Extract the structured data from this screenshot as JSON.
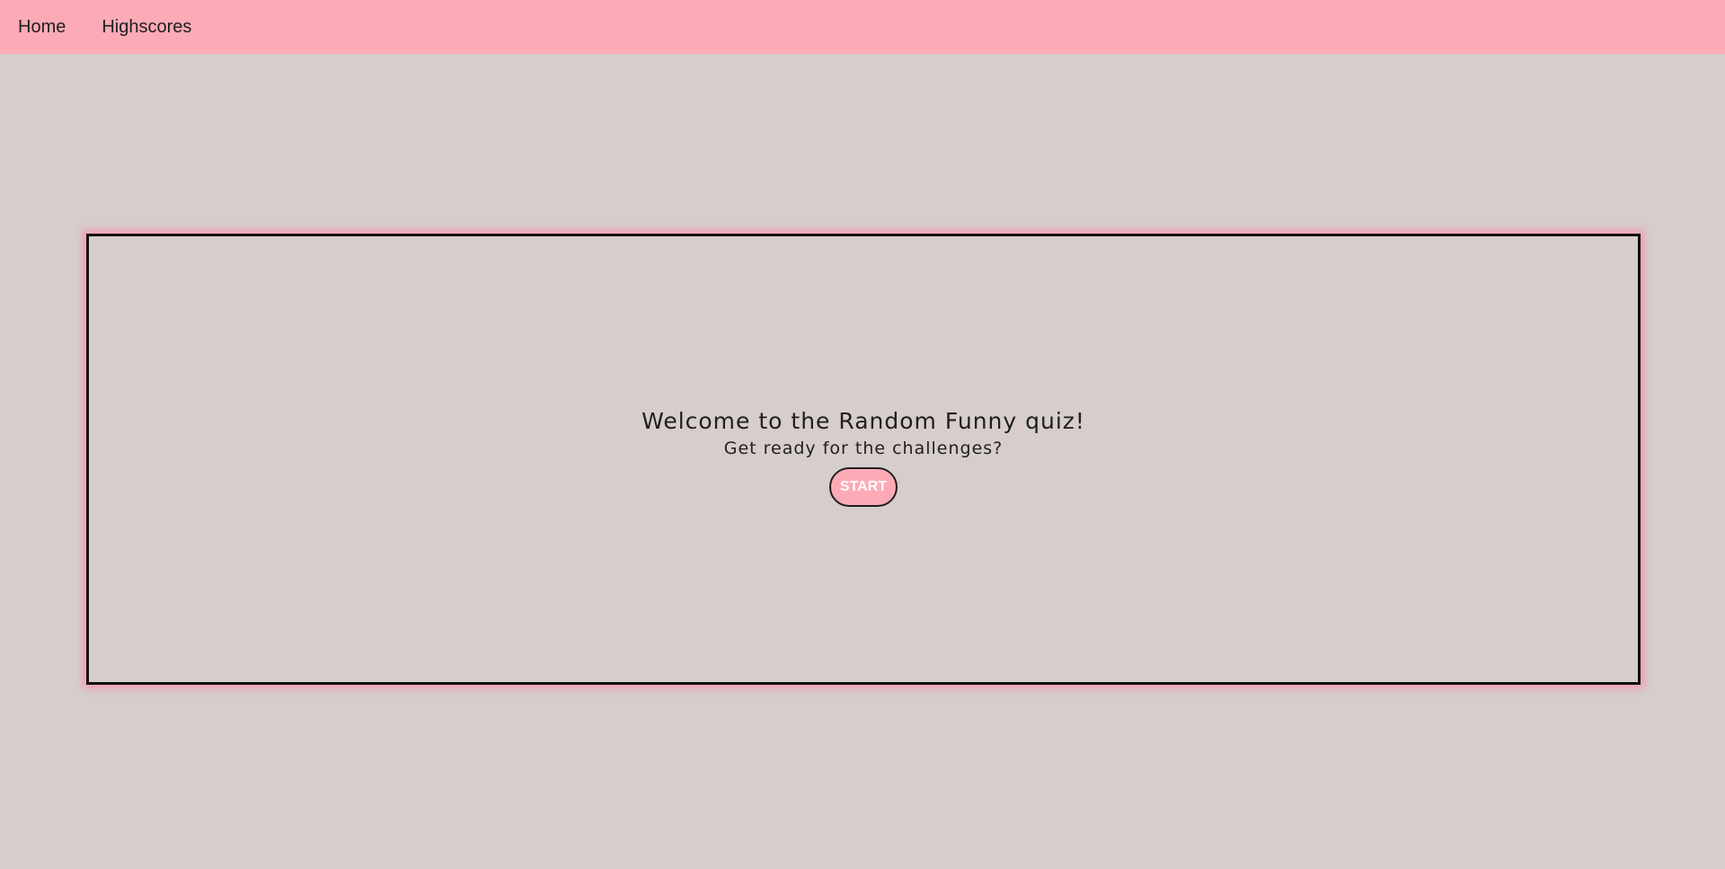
{
  "nav": {
    "home_label": "Home",
    "highscores_label": "Highscores"
  },
  "quiz": {
    "title": "Welcome to the Random Funny quiz!",
    "subtitle": "Get ready for the challenges?",
    "start_label": "START"
  },
  "colors": {
    "navbar_bg": "#fdaab7",
    "page_bg": "#d6cdcc",
    "button_bg": "#fdaab7",
    "border": "#111111"
  }
}
